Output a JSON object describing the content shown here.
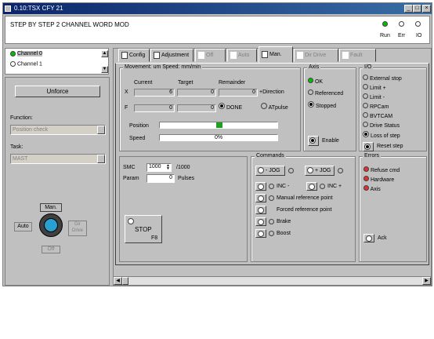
{
  "window": {
    "title": "0.10:TSX CFY 21",
    "min": "_",
    "max": "□",
    "close": "×"
  },
  "header": {
    "heading": "STEP BY STEP 2 CHANNEL WORD MOD",
    "indicators": [
      "Run",
      "Err",
      "IO"
    ]
  },
  "channels": [
    "Channel 0",
    "Channel 1"
  ],
  "left": {
    "unforce": "Unforce",
    "function_label": "Function:",
    "function_value": "Position check",
    "task_label": "Task:",
    "task_value": "MAST",
    "mode_man": "Man.",
    "mode_auto": "Auto",
    "mode_dir": "Dir\nDrive",
    "mode_off": "Off"
  },
  "tabs": [
    "Config",
    "Adjustment",
    "Off",
    "Auto",
    "Man.",
    "Dir Drive",
    "Fault"
  ],
  "movement": {
    "title": "Movement: um   Speed: mm/min",
    "col_current": "Current",
    "col_target": "Target",
    "col_remainder": "Remainder",
    "row_x": "X",
    "row_f": "F",
    "x_current": "6",
    "x_target": "0",
    "x_remainder": "0",
    "f_current": "0",
    "f_target": "0",
    "direction": "+Direction",
    "done": "DONE",
    "atpulse": "ATpulse",
    "position_label": "Position",
    "speed_label": "Speed",
    "speed_value": "0%"
  },
  "axis": {
    "title": "Axis",
    "ok": "OK",
    "referenced": "Referenced",
    "stopped": "Stopped",
    "enable": "Enable"
  },
  "io": {
    "title": "I/O",
    "items": [
      "External stop",
      "Limit +",
      "Limit -",
      "RPCam",
      "BVTCAM",
      "Drive Status",
      "Loss of step"
    ],
    "reset": "Reset step"
  },
  "smc": {
    "smc_label": "SMC",
    "smc_value": "1000",
    "smc_unit": "/1000",
    "param_label": "Param",
    "param_value": "0",
    "param_unit": "Pulses",
    "stop": "STOP",
    "stop_key": "F8"
  },
  "commands": {
    "title": "Commands",
    "jog_minus": "- JOG",
    "jog_plus": "+ JOG",
    "inc_minus": "INC -",
    "inc_plus": "INC +",
    "manual_ref": "Manual reference point",
    "forced_ref": "Forced reference point",
    "brake": "Brake",
    "boost": "Boost"
  },
  "errors": {
    "title": "Errors",
    "items": [
      "Refuse cmd",
      "Hardware",
      "Axis"
    ],
    "ack": "Ack"
  },
  "colors": {
    "title_start": "#0a246a",
    "title_end": "#3a6ea5",
    "led_green": "#00c000",
    "led_red": "#e03030",
    "pos_green": "#20a020"
  }
}
